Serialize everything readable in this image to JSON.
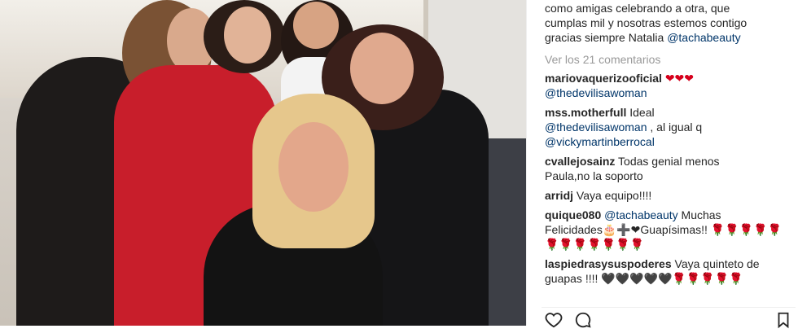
{
  "post": {
    "image_alt": "",
    "caption_lines": [
      "como amigas celebrando a otra, que",
      "cumplas mil y nosotras estemos contigo",
      "gracias siempre Natalia"
    ],
    "caption_mention": "@tachabeauty",
    "view_all": "Ver los 21 comentarios"
  },
  "comments": [
    {
      "user": "mariovaquerizooficial",
      "text": "",
      "hearts": "❤❤❤"
    },
    {
      "user": "",
      "mention": "@thedevilisawoman"
    },
    {
      "user": "mss.motherfull",
      "text": "Ideal"
    },
    {
      "user": "",
      "mention": "@thedevilisawoman",
      "text": ", al igual q"
    },
    {
      "user": "",
      "mention": "@vickymartinberrocal"
    },
    {
      "user": "cvallejosainz",
      "text": "Todas genial menos"
    },
    {
      "user": "",
      "text": "Paula,no la soporto"
    },
    {
      "user": "arridj",
      "text": "Vaya equipo!!!!"
    },
    {
      "user": "quique080",
      "mention": "@tachabeauty",
      "text": "Muchas"
    },
    {
      "user": "",
      "text": "Felicidades🎂➕❤Guapísimas!! 🌹🌹🌹🌹🌹"
    },
    {
      "user": "",
      "text": "🌹🌹🌹🌹🌹🌹🌹"
    },
    {
      "user": "laspiedrasysuspoderes",
      "text": "Vaya quinteto de"
    },
    {
      "user": "",
      "text": "guapas !!!! 🖤🖤🖤🖤🖤🌹🌹🌹🌹🌹"
    }
  ],
  "colors": {
    "link": "#003569",
    "muted": "#999999",
    "text": "#262626",
    "heart": "#d6001c"
  },
  "icons": [
    "like-icon",
    "comment-icon",
    "bookmark-icon"
  ]
}
